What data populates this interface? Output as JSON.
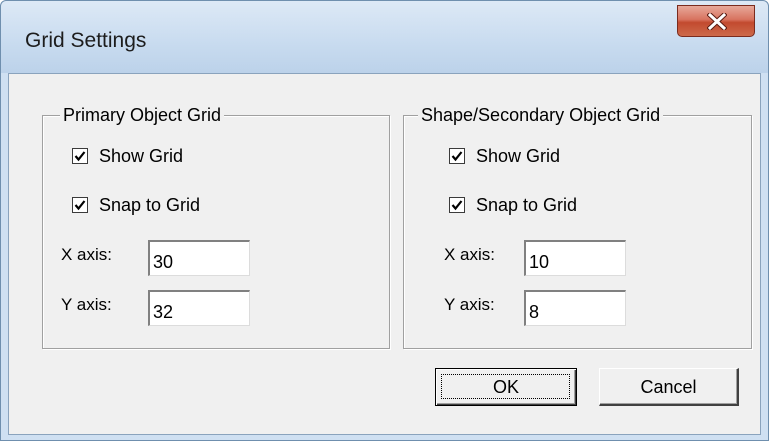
{
  "window": {
    "title": "Grid Settings",
    "close_icon": "close-icon"
  },
  "primary_group": {
    "title": "Primary Object Grid",
    "show_grid": {
      "label": "Show Grid",
      "checked": true
    },
    "snap_to_grid": {
      "label": "Snap to Grid",
      "checked": true
    },
    "x_axis": {
      "label": "X axis:",
      "value": "30"
    },
    "y_axis": {
      "label": "Y axis:",
      "value": "32"
    }
  },
  "secondary_group": {
    "title": "Shape/Secondary Object Grid",
    "show_grid": {
      "label": "Show Grid",
      "checked": true
    },
    "snap_to_grid": {
      "label": "Snap to Grid",
      "checked": true
    },
    "x_axis": {
      "label": "X axis:",
      "value": "10"
    },
    "y_axis": {
      "label": "Y axis:",
      "value": "8"
    }
  },
  "buttons": {
    "ok_label": "OK",
    "cancel_label": "Cancel"
  },
  "colors": {
    "frame": "#cfe0f2",
    "client": "#f0f0f0",
    "close_button": "#c75a41"
  }
}
